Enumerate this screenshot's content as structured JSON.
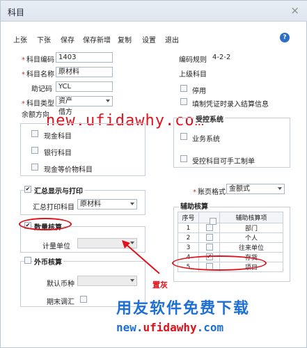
{
  "window": {
    "title": "科目",
    "close_glyph": "×"
  },
  "toolbar": {
    "buttons": [
      "上张",
      "下张",
      "保存",
      "保存新增",
      "复制",
      "设置",
      "退出"
    ],
    "help_glyph": "?"
  },
  "form": {
    "code": {
      "label": "科目编码",
      "value": "1403"
    },
    "name": {
      "label": "科目名称",
      "value": "原材料"
    },
    "mnemonic": {
      "label": "助记码",
      "value": "YCL"
    },
    "type": {
      "label": "科目类型",
      "value": "资产"
    },
    "balance": {
      "label": "余额方向",
      "value": "借方"
    },
    "cash": "现金科目",
    "bank": "银行科目",
    "cash_equiv": "现金等价物科目"
  },
  "right": {
    "code_rule_label": "编码规则",
    "code_rule_value": "4-2-2",
    "parent_label": "上级科目",
    "disabled": "停用",
    "settle_info": "填制凭证时录入结算信息",
    "control_label": "受控系统",
    "business_system": "业务系统",
    "manual_entry": "受控科目可手工制单",
    "ledger_format_label": "账页格式",
    "ledger_format_value": "金额式"
  },
  "summary_group": {
    "title": "汇总显示与打印",
    "print_label": "汇总打印科目",
    "print_value": "原材料"
  },
  "qty_group": {
    "title": "数量核算",
    "unit_label": "计量单位"
  },
  "fx_group": {
    "title": "外币核算",
    "currency_label": "默认币种",
    "period_adjust": "期末调汇"
  },
  "aux": {
    "title": "辅助核算",
    "headers": [
      "序号",
      "",
      "辅助核算项"
    ],
    "rows": [
      {
        "no": "1",
        "checked": false,
        "item": "部门"
      },
      {
        "no": "2",
        "checked": false,
        "item": "个人"
      },
      {
        "no": "3",
        "checked": false,
        "item": "往来单位"
      },
      {
        "no": "4",
        "checked": true,
        "item": "存货"
      },
      {
        "no": "5",
        "checked": false,
        "item": "项目"
      }
    ]
  },
  "annotations": {
    "gray_note": "置灰"
  },
  "watermark": {
    "url_top": "new.ufidawhy.com",
    "brand_cn": "用友软件免费下载",
    "url_prefix": "new.",
    "url_highlight": "ufidawhy",
    "url_suffix": ".com"
  }
}
